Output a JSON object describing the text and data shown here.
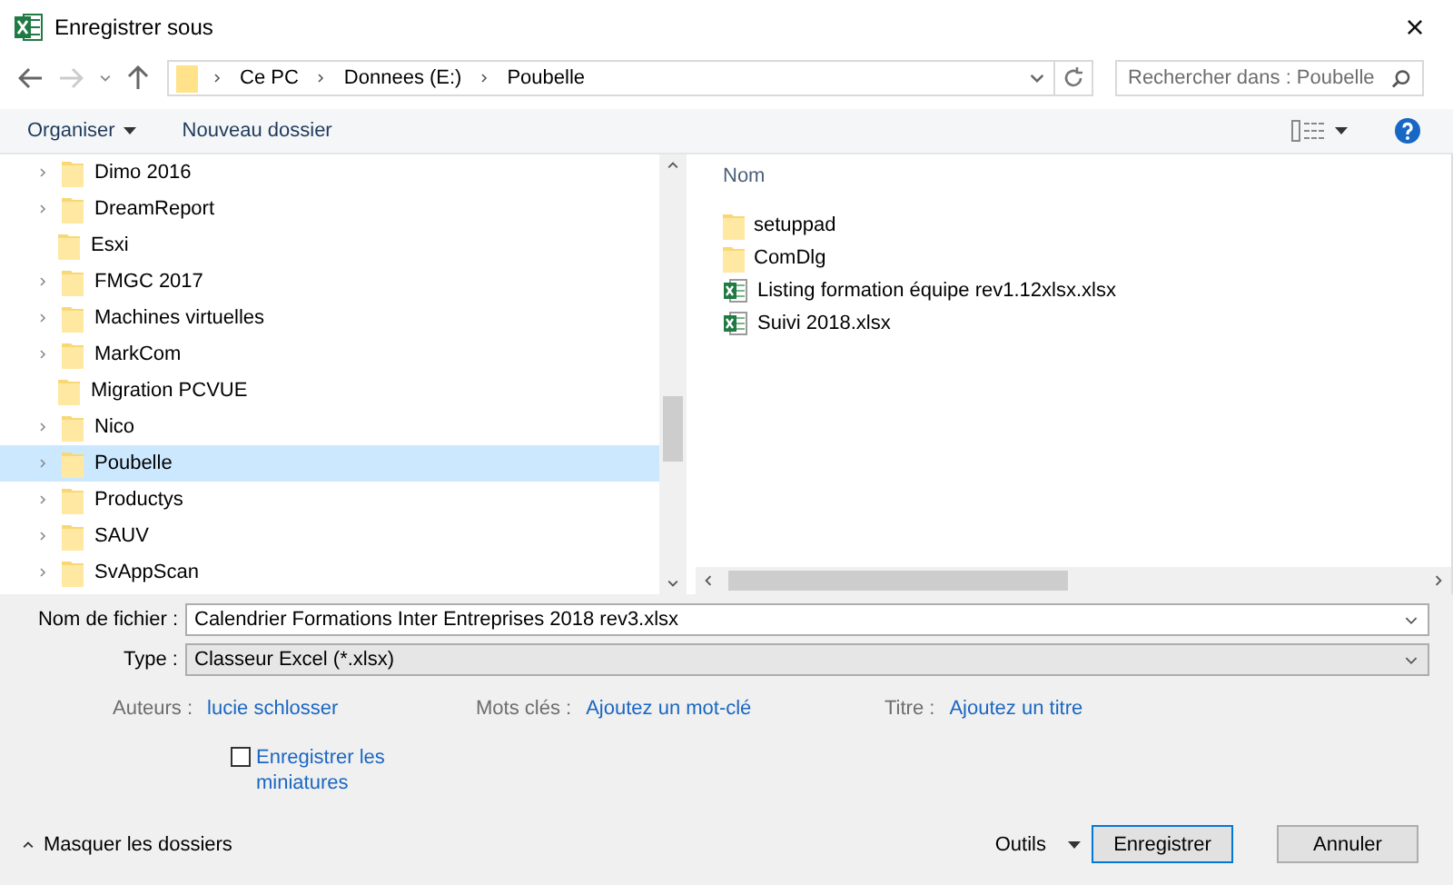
{
  "window": {
    "title": "Enregistrer sous",
    "close": "×"
  },
  "address": {
    "crumbs": [
      "Ce PC",
      "Donnees (E:)",
      "Poubelle"
    ]
  },
  "search": {
    "placeholder": "Rechercher dans : Poubelle"
  },
  "toolbar": {
    "organize": "Organiser",
    "new_folder": "Nouveau dossier"
  },
  "tree": [
    {
      "name": "Dimo 2016",
      "expandable": true,
      "selected": false
    },
    {
      "name": "DreamReport",
      "expandable": true,
      "selected": false
    },
    {
      "name": "Esxi",
      "expandable": false,
      "selected": false
    },
    {
      "name": "FMGC 2017",
      "expandable": true,
      "selected": false
    },
    {
      "name": "Machines virtuelles",
      "expandable": true,
      "selected": false
    },
    {
      "name": "MarkCom",
      "expandable": true,
      "selected": false
    },
    {
      "name": "Migration PCVUE",
      "expandable": false,
      "selected": false
    },
    {
      "name": "Nico",
      "expandable": true,
      "selected": false
    },
    {
      "name": "Poubelle",
      "expandable": true,
      "selected": true
    },
    {
      "name": "Productys",
      "expandable": true,
      "selected": false
    },
    {
      "name": "SAUV",
      "expandable": true,
      "selected": false
    },
    {
      "name": "SvAppScan",
      "expandable": true,
      "selected": false
    }
  ],
  "files": {
    "column": "Nom",
    "items": [
      {
        "name": "setuppad",
        "kind": "folder"
      },
      {
        "name": "ComDlg",
        "kind": "folder"
      },
      {
        "name": "Listing formation équipe rev1.12xlsx.xlsx",
        "kind": "excel"
      },
      {
        "name": "Suivi 2018.xlsx",
        "kind": "excel"
      }
    ]
  },
  "form": {
    "filename_label": "Nom de fichier :",
    "filename": "Calendrier Formations Inter Entreprises 2018 rev3.xlsx",
    "type_label": "Type :",
    "type": "Classeur Excel (*.xlsx)"
  },
  "meta": [
    {
      "label": "Auteurs :",
      "value": "lucie schlosser"
    },
    {
      "label": "Mots clés :",
      "value": "Ajoutez un mot-clé"
    },
    {
      "label": "Titre :",
      "value": "Ajoutez un titre"
    }
  ],
  "thumbnails": {
    "label": "Enregistrer les miniatures",
    "checked": false
  },
  "footer": {
    "hide_folders": "Masquer les dossiers",
    "tools": "Outils",
    "save": "Enregistrer",
    "cancel": "Annuler"
  }
}
